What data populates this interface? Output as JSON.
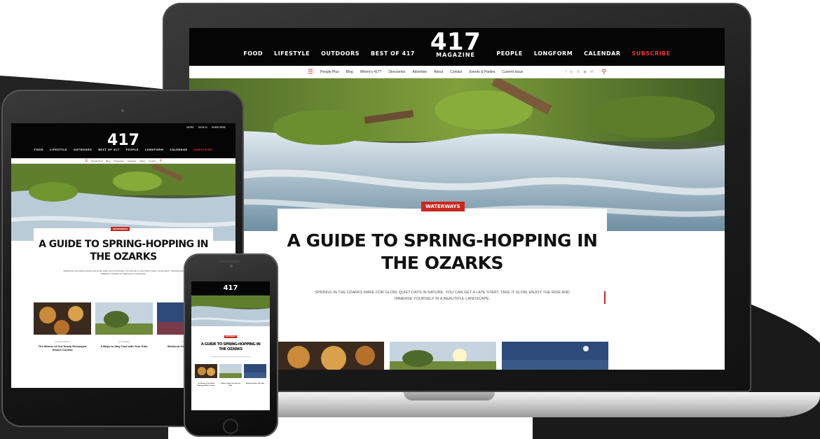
{
  "site": {
    "logo_number": "417",
    "logo_word": "MAGAZINE",
    "nav": [
      "FOOD",
      "LIFESTYLE",
      "OUTDOORS",
      "BEST OF 417",
      "PEOPLE",
      "LONGFORM",
      "CALENDAR",
      "SUBSCRIBE"
    ],
    "subnav": [
      "People Plus",
      "Blog",
      "Where's 417?",
      "Directories",
      "Advertise",
      "About",
      "Contact",
      "Events & Parties",
      "Current Issue"
    ],
    "tablet_util": [
      "MORE",
      "SIGN IN",
      "SUBSCRIBE"
    ]
  },
  "article": {
    "tag": "WATERWAYS",
    "title_line1": "A GUIDE TO SPRING-HOPPING IN",
    "title_line2": "THE OZARKS",
    "dek_line1": "SPRINGS IN THE OZARKS MAKE FOR GLOW, QUIET DAYS IN NATURE. YOU CAN GET A LATE START, TAKE IT SLOW, ENJOY THE RIDE AND",
    "dek_line2": "IMMERSE YOURSELF IN A BEAUTIFUL LANDSCAPE."
  },
  "related": [
    {
      "kicker": "FOOD & DRINK",
      "title": "The Winner of Our Newly Revamped Dishes Contest"
    },
    {
      "kicker": "OUTDOORS",
      "title": "5 Ways to Stay Cool with Your Kids"
    },
    {
      "kicker": "EVENTS",
      "title": "Weekend Guide to 417-land"
    }
  ],
  "colors": {
    "brand_red": "#c8281e",
    "header_black": "#050505",
    "device_dark": "#1b1b1b"
  }
}
